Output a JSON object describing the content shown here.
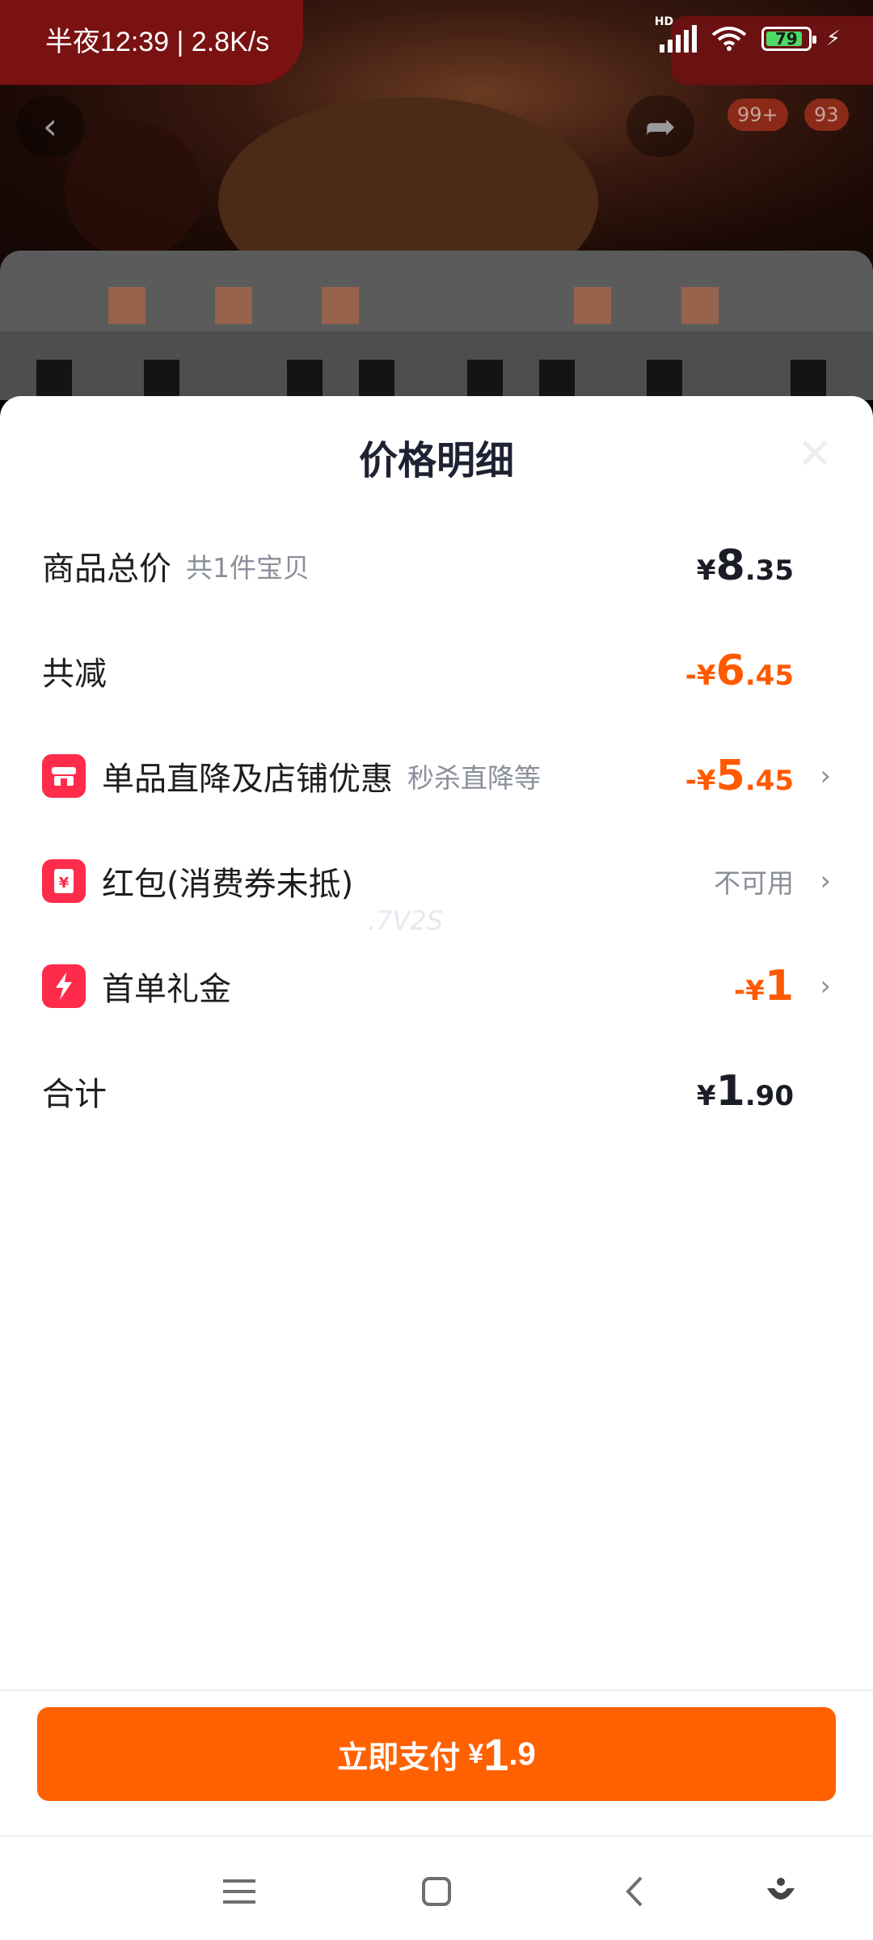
{
  "status_bar": {
    "time_network": "半夜12:39 | 2.8K/s",
    "signal_label": "HD",
    "battery": "79"
  },
  "background": {
    "cart_badge": "99+",
    "other_badge": "93"
  },
  "sheet": {
    "title": "价格明细",
    "rows": [
      {
        "label": "商品总价",
        "sub": "共1件宝贝",
        "currency": "¥",
        "int": "8",
        "dec": ".35",
        "color": "dark"
      },
      {
        "label": "共减",
        "currency": "-¥",
        "int": "6",
        "dec": ".45",
        "color": "orange"
      },
      {
        "label": "单品直降及店铺优惠",
        "sub": "秒杀直降等",
        "currency": "-¥",
        "int": "5",
        "dec": ".45",
        "icon": "store-icon"
      },
      {
        "label": "红包(消费券未抵)",
        "status": "不可用",
        "icon": "red-packet-icon"
      },
      {
        "label": "首单礼金",
        "currency": "-¥",
        "int": "1",
        "icon": "lightning-icon"
      },
      {
        "label": "合计",
        "currency": "¥",
        "int": "1",
        "dec": ".90",
        "color": "dark"
      }
    ],
    "watermark": ".7V2S"
  },
  "pay_button": {
    "label": "立即支付",
    "currency": "¥",
    "int": "1",
    "dec": ".9"
  },
  "colors": {
    "accent": "#ff6100",
    "discount": "#ff5a00",
    "icon_red": "#ff2b4b"
  }
}
